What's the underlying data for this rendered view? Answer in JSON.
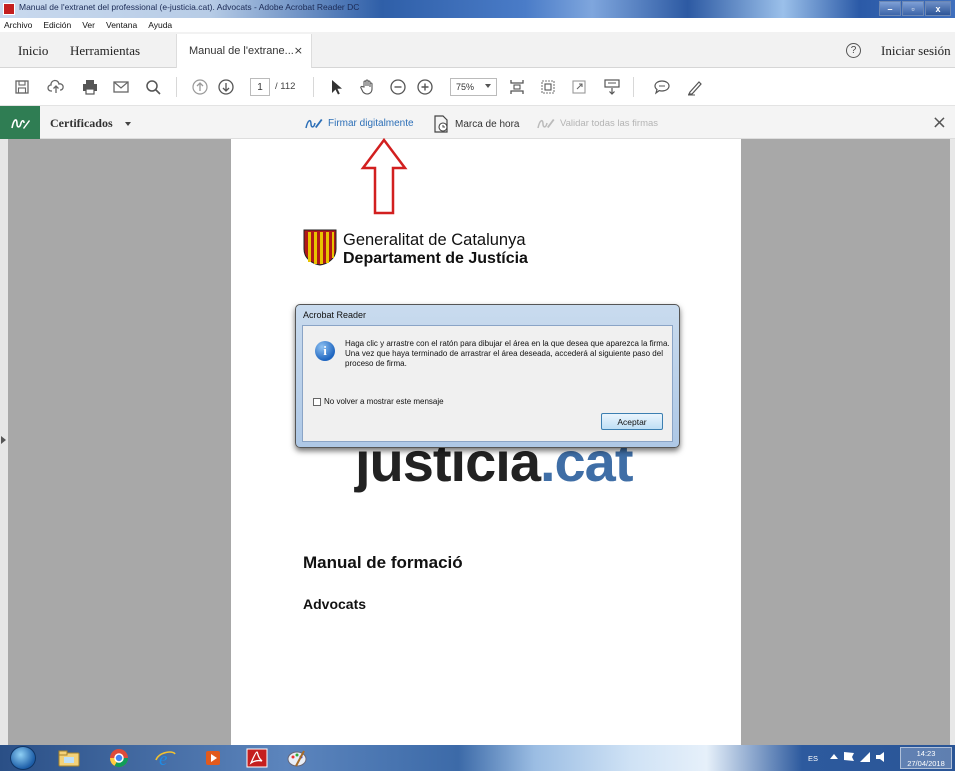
{
  "window": {
    "title": "Manual de l'extranet del professional (e-justicia.cat). Advocats - Adobe Acrobat Reader DC",
    "minimize_label": "–",
    "maximize_label": "▫",
    "close_label": "x"
  },
  "menubar": {
    "items": [
      {
        "label": "Archivo"
      },
      {
        "label": "Edición"
      },
      {
        "label": "Ver"
      },
      {
        "label": "Ventana"
      },
      {
        "label": "Ayuda"
      }
    ]
  },
  "tabs": {
    "home": "Inicio",
    "tools": "Herramientas",
    "document": "Manual de l'extrane...",
    "document_close": "×",
    "signin": "Iniciar sesión",
    "help_icon": "?"
  },
  "toolbar": {
    "page_current": "1",
    "page_total": "/ 112",
    "zoom": "75%"
  },
  "signbar": {
    "certificates": "Certificados",
    "sign_digitally": "Firmar digitalmente",
    "timestamp": "Marca de hora",
    "validate_all": "Validar todas las firmas",
    "close": "×"
  },
  "document": {
    "org_line1": "Generalitat de Catalunya",
    "org_line2": "Departament de Justícia",
    "brand_main": "justicia",
    "brand_ext": ".cat",
    "heading": "Manual de formació",
    "subheading": "Advocats"
  },
  "dialog": {
    "title": "Acrobat Reader",
    "message": "Haga clic y arrastre con el ratón para dibujar el área en la que desea que aparezca la firma. Una vez que haya terminado de arrastrar el área deseada, accederá al siguiente paso del proceso de firma.",
    "checkbox_label": "No volver a mostrar este mensaje",
    "ok_button": "Aceptar",
    "info_glyph": "i"
  },
  "taskbar": {
    "language": "ES",
    "time": "14:23",
    "date": "27/04/2018"
  },
  "colors": {
    "sign_accent": "#2f7d53",
    "link_blue": "#2d6fb7",
    "annotation_arrow": "#d21f1f",
    "brand_dot": "#3f6ea6"
  }
}
